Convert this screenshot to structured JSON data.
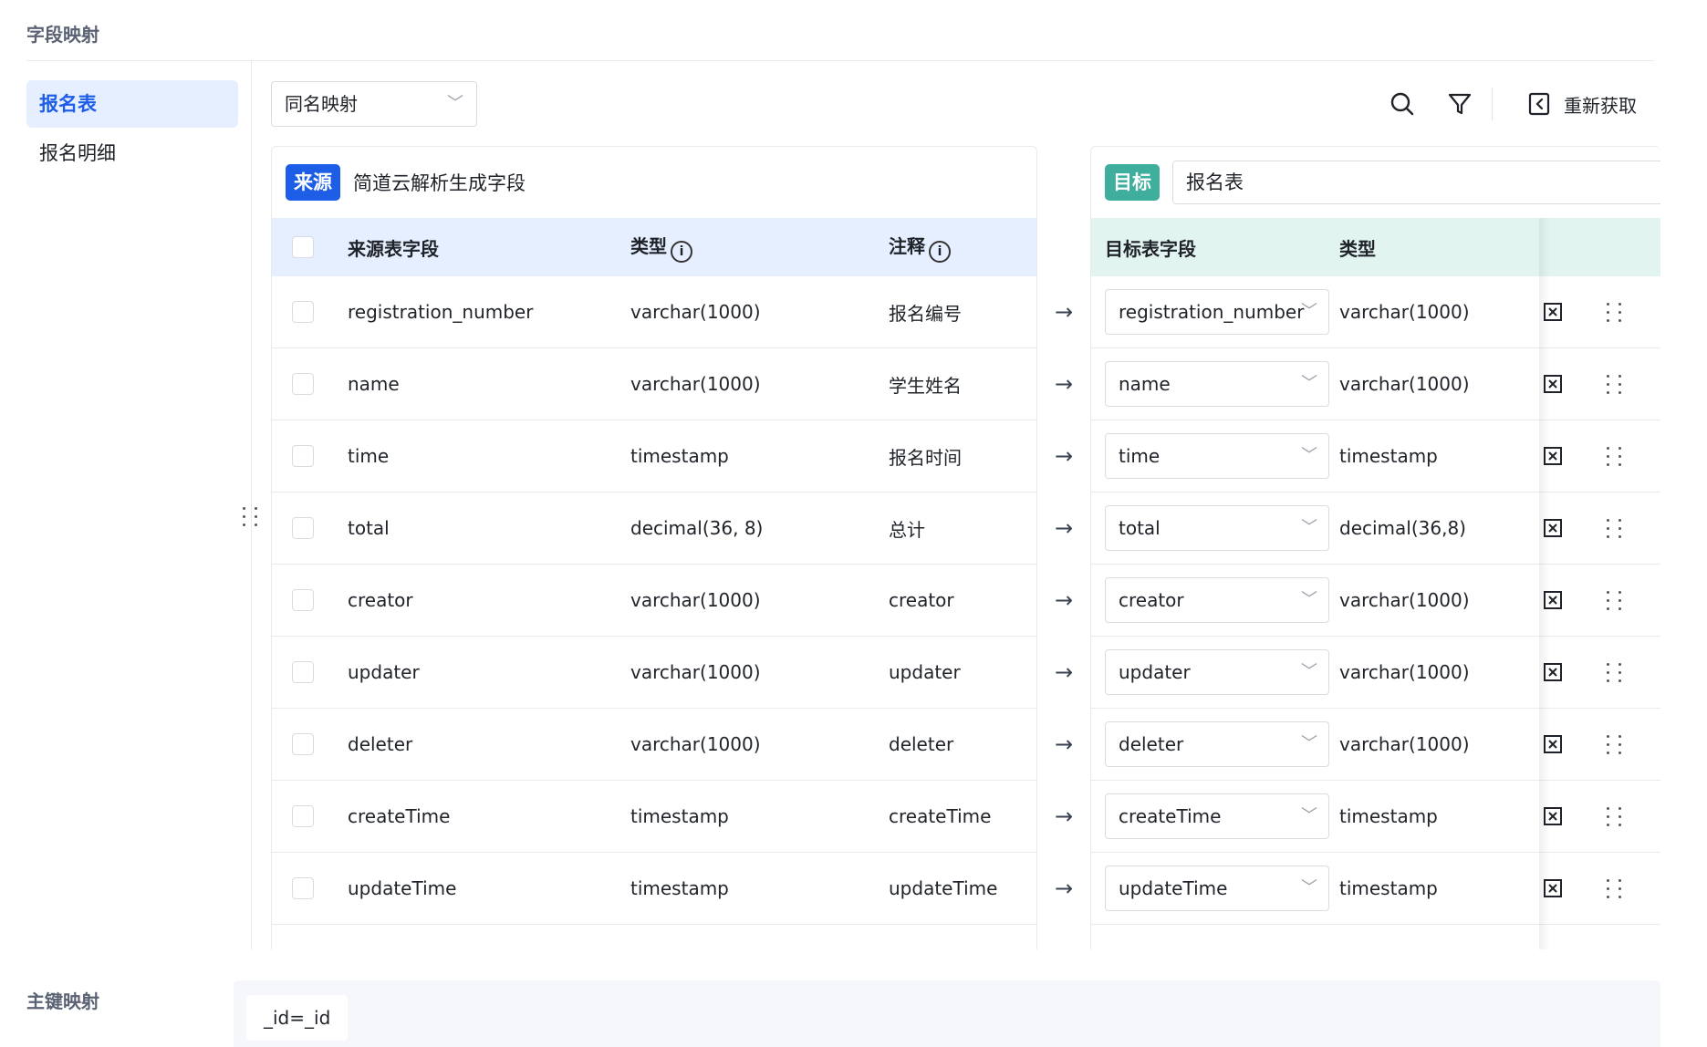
{
  "section_titles": {
    "field_mapping": "字段映射",
    "primary_key_mapping": "主键映射"
  },
  "sidebar": {
    "items": [
      {
        "label": "报名表",
        "active": true
      },
      {
        "label": "报名明细",
        "active": false
      }
    ]
  },
  "toolbar": {
    "mode_select": "同名映射",
    "refetch_label": "重新获取",
    "icons": [
      "search-icon",
      "filter-icon",
      "refresh-icon"
    ]
  },
  "source": {
    "tag": "来源",
    "description": "简道云解析生成字段",
    "headers": {
      "field": "来源表字段",
      "type": "类型",
      "note": "注释"
    },
    "rows": [
      {
        "field": "registration_number",
        "type": "varchar(1000)",
        "note": "报名编号"
      },
      {
        "field": "name",
        "type": "varchar(1000)",
        "note": "学生姓名"
      },
      {
        "field": "time",
        "type": "timestamp",
        "note": "报名时间"
      },
      {
        "field": "total",
        "type": "decimal(36, 8)",
        "note": "总计"
      },
      {
        "field": "creator",
        "type": "varchar(1000)",
        "note": "creator"
      },
      {
        "field": "updater",
        "type": "varchar(1000)",
        "note": "updater"
      },
      {
        "field": "deleter",
        "type": "varchar(1000)",
        "note": "deleter"
      },
      {
        "field": "createTime",
        "type": "timestamp",
        "note": "createTime"
      },
      {
        "field": "updateTime",
        "type": "timestamp",
        "note": "updateTime"
      }
    ]
  },
  "target": {
    "tag": "目标",
    "table_name": "报名表",
    "headers": {
      "field": "目标表字段",
      "type": "类型"
    },
    "rows": [
      {
        "field": "registration_number",
        "type": "varchar(1000)"
      },
      {
        "field": "name",
        "type": "varchar(1000)"
      },
      {
        "field": "time",
        "type": "timestamp"
      },
      {
        "field": "total",
        "type": "decimal(36,8)"
      },
      {
        "field": "creator",
        "type": "varchar(1000)"
      },
      {
        "field": "updater",
        "type": "varchar(1000)"
      },
      {
        "field": "deleter",
        "type": "varchar(1000)"
      },
      {
        "field": "createTime",
        "type": "timestamp"
      },
      {
        "field": "updateTime",
        "type": "timestamp"
      }
    ]
  },
  "primary_key": {
    "value": "_id=_id"
  },
  "colors": {
    "accent": "#1e5ee6",
    "target_accent": "#3fae9c",
    "source_header_bg": "#e6efff",
    "target_header_bg": "#e2f4f0"
  }
}
